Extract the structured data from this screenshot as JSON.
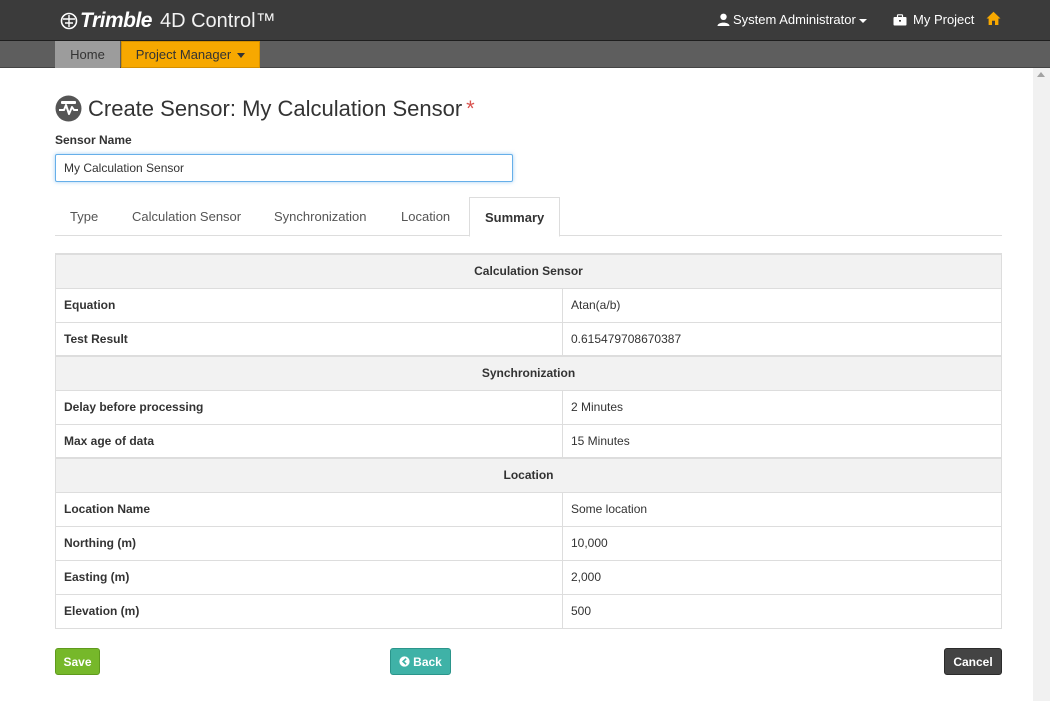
{
  "header": {
    "brand_name": "Trimble",
    "product_name": "4D Control™",
    "user_label": "System Administrator",
    "project_label": "My Project"
  },
  "nav": {
    "home_label": "Home",
    "project_manager_label": "Project Manager"
  },
  "page": {
    "title": "Create Sensor: My Calculation Sensor",
    "required_mark": "*",
    "sensor_name_label": "Sensor Name",
    "sensor_name_value": "My Calculation Sensor"
  },
  "tabs": [
    {
      "label": "Type"
    },
    {
      "label": "Calculation Sensor"
    },
    {
      "label": "Synchronization"
    },
    {
      "label": "Location"
    },
    {
      "label": "Summary",
      "active": true
    }
  ],
  "summary": {
    "calculation": {
      "title": "Calculation Sensor",
      "rows": [
        {
          "key": "Equation",
          "value": "Atan(a/b)"
        },
        {
          "key": "Test Result",
          "value": "0.615479708670387"
        }
      ]
    },
    "synchronization": {
      "title": "Synchronization",
      "rows": [
        {
          "key": "Delay before processing",
          "value": "2 Minutes"
        },
        {
          "key": "Max age of data",
          "value": "15 Minutes"
        }
      ]
    },
    "location": {
      "title": "Location",
      "rows": [
        {
          "key": "Location Name",
          "value": "Some location"
        },
        {
          "key": "Northing (m)",
          "value": "10,000"
        },
        {
          "key": "Easting (m)",
          "value": "2,000"
        },
        {
          "key": "Elevation (m)",
          "value": "500"
        }
      ]
    }
  },
  "buttons": {
    "save": "Save",
    "back": "Back",
    "cancel": "Cancel"
  },
  "colors": {
    "header_bg": "#3b3b3b",
    "nav_bg": "#5e5e5e",
    "accent_orange": "#f7a800",
    "save_green": "#76b82a",
    "back_teal": "#3fb2a7",
    "cancel_dark": "#444444",
    "required_red": "#d9534f"
  },
  "icons": {
    "brand": "trimble-logo-icon",
    "user": "user-icon",
    "project": "briefcase-icon",
    "home": "home-icon",
    "title": "sensor-icon",
    "back": "arrow-circle-left-icon"
  }
}
